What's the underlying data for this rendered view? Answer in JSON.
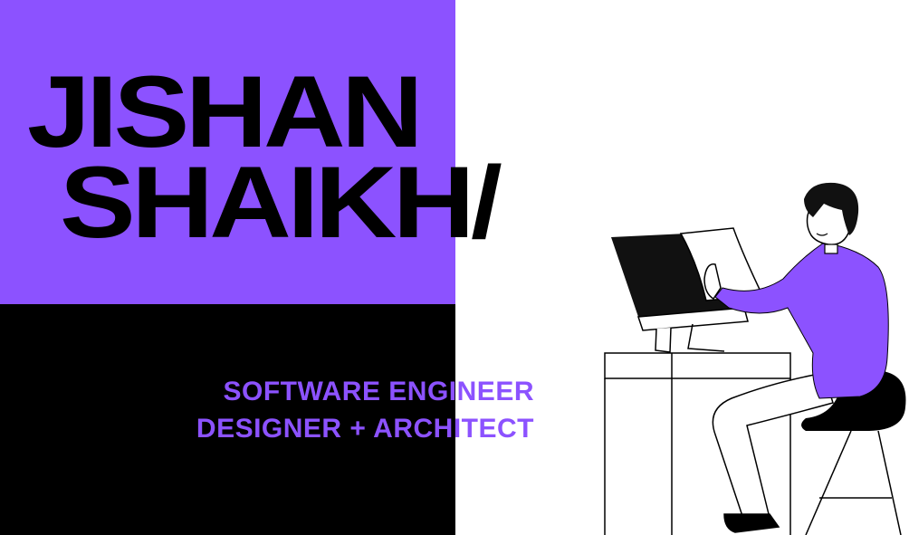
{
  "hero": {
    "first_name": "JISHAN",
    "last_name": "SHAIKH/",
    "tagline_1": "SOFTWARE ENGINEER",
    "tagline_2": "DESIGNER + ARCHITECT"
  },
  "colors": {
    "accent": "#8c52ff",
    "dark": "#000000",
    "background": "#ffffff"
  },
  "illustration": {
    "icon": "person-at-computer-icon"
  }
}
